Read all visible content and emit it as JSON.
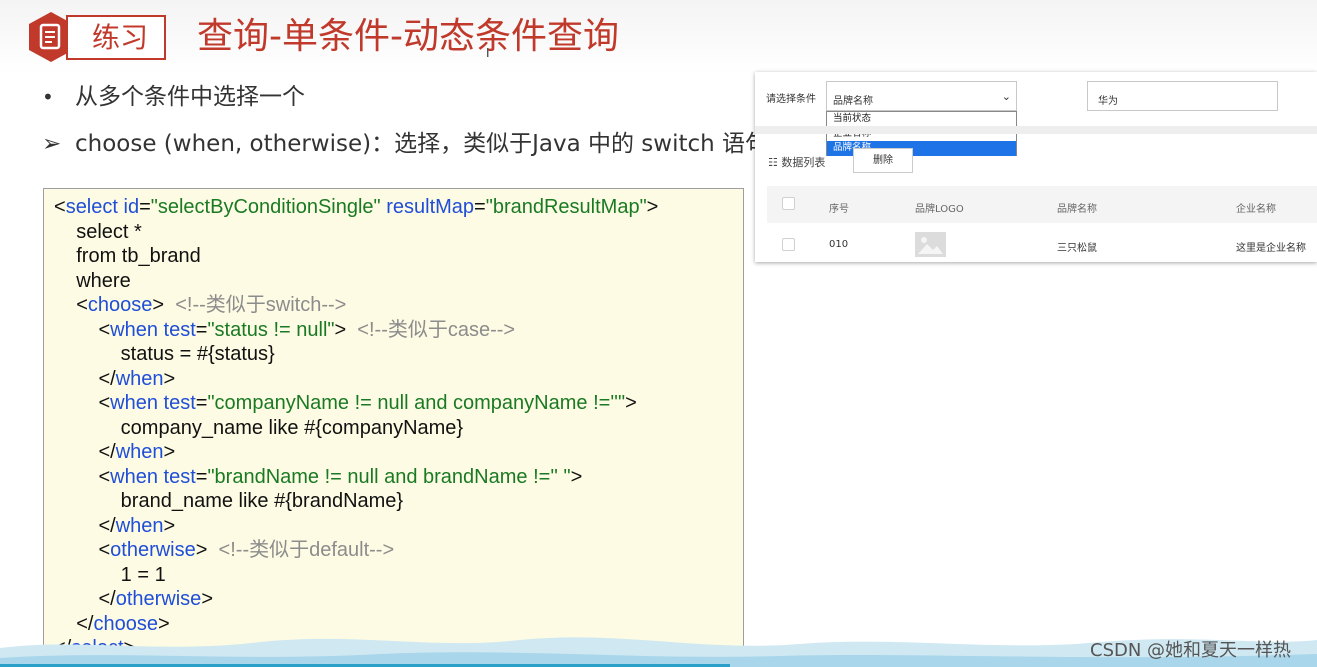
{
  "header": {
    "badge_label": "练习",
    "title": "查询-单条件-动态条件查询"
  },
  "bullets": [
    {
      "mark": "•",
      "text": "从多个条件中选择一个"
    },
    {
      "mark": "➢",
      "text": "choose (when, otherwise)：选择，类似于Java 中的 switch 语句"
    }
  ],
  "code_lines": [
    "<select id=\"selectByConditionSingle\" resultMap=\"brandResultMap\">",
    "    select *",
    "    from tb_brand",
    "    where",
    "    <choose>  <!--类似于switch-->",
    "        <when test=\"status != null\">  <!--类似于case-->",
    "            status = #{status}",
    "        </when>",
    "        <when test=\"companyName != null and companyName !=''\">",
    "            company_name like #{companyName}",
    "        </when>",
    "        <when test=\"brandName != null and brandName !='' \">",
    "            brand_name like #{brandName}",
    "        </when>",
    "        <otherwise>  <!--类似于default-->",
    "            1 = 1",
    "        </otherwise>",
    "    </choose>",
    "</select>"
  ],
  "ui": {
    "condition_label": "请选择条件",
    "select_value": "品牌名称",
    "options": [
      "当前状态",
      "企业名称",
      "品牌名称"
    ],
    "selected_index": 2,
    "search_value": "华为",
    "list_label": "数据列表",
    "delete_label": "删除",
    "columns": [
      "序号",
      "品牌LOGO",
      "品牌名称",
      "企业名称"
    ],
    "row": {
      "id": "010",
      "brand_name": "三只松鼠",
      "company_name": "这里是企业名称"
    }
  },
  "watermark": "CSDN @她和夏天一样热",
  "colors": {
    "accent": "#c0392b",
    "keyword": "#1f4ed8",
    "string": "#1a7a24",
    "comment": "#8c8c8c",
    "code_bg": "#fdfbe3",
    "selected_option": "#1e74e6"
  }
}
